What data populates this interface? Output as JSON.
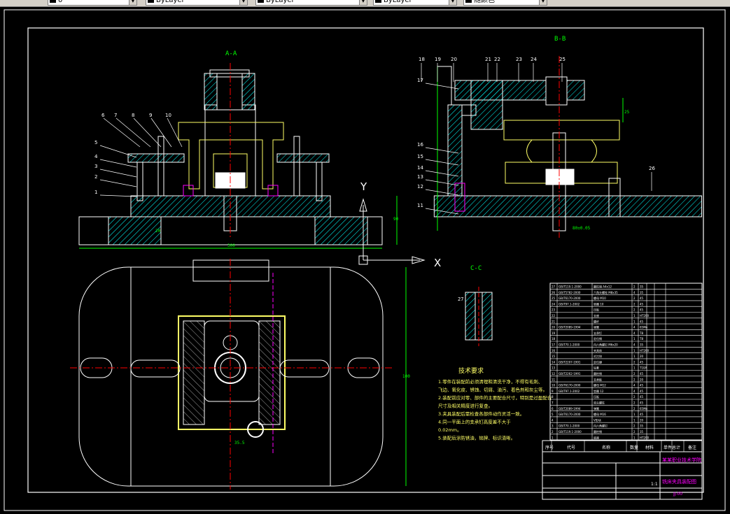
{
  "toolbar": {
    "combos": [
      {
        "name": "layer-combo",
        "value": "0",
        "interactable": true
      },
      {
        "name": "color-combo",
        "value": "ByLayer",
        "interactable": true
      },
      {
        "name": "linetype-combo",
        "value": "ByLayer",
        "interactable": true
      },
      {
        "name": "lineweight-combo",
        "value": "ByLayer",
        "interactable": true
      },
      {
        "name": "plotstyle-combo",
        "value": "随颜色",
        "interactable": true
      }
    ]
  },
  "views": {
    "section_aa": "A-A",
    "section_bb": "B-B",
    "section_cc": "C-C",
    "ucs_x": "X",
    "ucs_y": "Y"
  },
  "balloons_left": [
    "6",
    "7",
    "8",
    "9",
    "10",
    "5",
    "4",
    "3",
    "2",
    "1"
  ],
  "balloons_right_top": [
    "18",
    "19",
    "20",
    "21",
    "22",
    "23",
    "24",
    "25",
    "26"
  ],
  "balloons_right_side": [
    "17",
    "16",
    "15",
    "14",
    "13",
    "12",
    "11"
  ],
  "balloon_cc": "27",
  "tech_requirements": {
    "title": "技术要求",
    "lines": [
      "1.零件在装配前必须清理和清洗干净，不得有毛刺、",
      "飞边、氧化皮、锈蚀、切屑、油污、着色剂和灰尘等。",
      "2.装配前应对零、部件的主要配合尺寸，特别是过盈配合",
      "尺寸及相关精度进行复查。",
      "3.夹具装配后需检查各部件动作灵活一致。",
      "4.同一平面上的支承钉高度差不大于",
      "0.02mm。",
      "5.装配后涂防锈油，铭牌、标识清晰。"
    ]
  },
  "title_block": {
    "school": "某某职业技术学院",
    "drawing_name": "铣床夹具装配图",
    "drawing_no": "JJ-00",
    "scale": "1:1",
    "headers": [
      "序号",
      "代号",
      "名称",
      "数量",
      "材料",
      "单件",
      "总计",
      "备注"
    ]
  },
  "bom_rows": [
    {
      "no": "27",
      "code": "GB/T119.1-2000",
      "name": "圆柱销 A4x12",
      "qty": "2",
      "mat": "35"
    },
    {
      "no": "26",
      "code": "GB/T5782-2000",
      "name": "六角头螺栓 M8x35",
      "qty": "4",
      "mat": "35"
    },
    {
      "no": "25",
      "code": "GB/T6170-2000",
      "name": "螺母 M10",
      "qty": "2",
      "mat": "45"
    },
    {
      "no": "24",
      "code": "GB/T97.1-2002",
      "name": "垫圈 10",
      "qty": "2",
      "mat": "45"
    },
    {
      "no": "23",
      "code": "",
      "name": "压板",
      "qty": "2",
      "mat": "45"
    },
    {
      "no": "22",
      "code": "",
      "name": "支座",
      "qty": "1",
      "mat": "HT200"
    },
    {
      "no": "21",
      "code": "",
      "name": "螺杆",
      "qty": "1",
      "mat": "45"
    },
    {
      "no": "20",
      "code": "GB/T2089-1994",
      "name": "弹簧",
      "qty": "4",
      "mat": "65Mn"
    },
    {
      "no": "19",
      "code": "",
      "name": "支承钉",
      "qty": "4",
      "mat": "T8"
    },
    {
      "no": "18",
      "code": "",
      "name": "定位销",
      "qty": "1",
      "mat": "T8"
    },
    {
      "no": "17",
      "code": "GB/T70.1-2000",
      "name": "内六角螺钉 M6x20",
      "qty": "4",
      "mat": "35"
    },
    {
      "no": "16",
      "code": "",
      "name": "夹具体",
      "qty": "1",
      "mat": "HT200"
    },
    {
      "no": "15",
      "code": "",
      "name": "对刀块",
      "qty": "1",
      "mat": "20"
    },
    {
      "no": "14",
      "code": "GB/T2207-1991",
      "name": "定位键",
      "qty": "2",
      "mat": "45"
    },
    {
      "no": "13",
      "code": "",
      "name": "钻套",
      "qty": "1",
      "mat": "T10A"
    },
    {
      "no": "12",
      "code": "GB/T2262-1991",
      "name": "圆柱销",
      "qty": "2",
      "mat": "45"
    },
    {
      "no": "11",
      "code": "",
      "name": "支承板",
      "qty": "2",
      "mat": "20"
    },
    {
      "no": "10",
      "code": "GB/T6170-2000",
      "name": "螺母 M12",
      "qty": "4",
      "mat": "45"
    },
    {
      "no": "9",
      "code": "GB/T97.1-2002",
      "name": "垫圈 12",
      "qty": "4",
      "mat": "45"
    },
    {
      "no": "8",
      "code": "",
      "name": "压板",
      "qty": "2",
      "mat": "45"
    },
    {
      "no": "7",
      "code": "",
      "name": "双头螺柱",
      "qty": "2",
      "mat": "45"
    },
    {
      "no": "6",
      "code": "GB/T2089-1994",
      "name": "弹簧",
      "qty": "2",
      "mat": "65Mn"
    },
    {
      "no": "5",
      "code": "GB/T6170-2000",
      "name": "螺母 M16",
      "qty": "1",
      "mat": "45"
    },
    {
      "no": "4",
      "code": "",
      "name": "V形块",
      "qty": "1",
      "mat": "20"
    },
    {
      "no": "3",
      "code": "GB/T70.1-2000",
      "name": "内六角螺钉",
      "qty": "2",
      "mat": "35"
    },
    {
      "no": "2",
      "code": "GB/T119.1-2000",
      "name": "圆柱销",
      "qty": "2",
      "mat": "35"
    },
    {
      "no": "1",
      "code": "",
      "name": "底座",
      "qty": "1",
      "mat": "HT200"
    }
  ],
  "dims": {
    "overall_width": "300",
    "height_left": "90",
    "dim_small": "20",
    "dim_right": "25",
    "dim_plan": "100",
    "dim_offset": "80±0.05",
    "dim_plan_small": "35.5"
  },
  "colors": {
    "frame": "#ffffff",
    "outline": "#ffffff",
    "dim": "#00ff00",
    "center": "#ff0000",
    "hatch": "#00ffff",
    "part_yellow": "#ffff66",
    "hidden": "#ff00ff",
    "balloon": "#ffffff"
  }
}
